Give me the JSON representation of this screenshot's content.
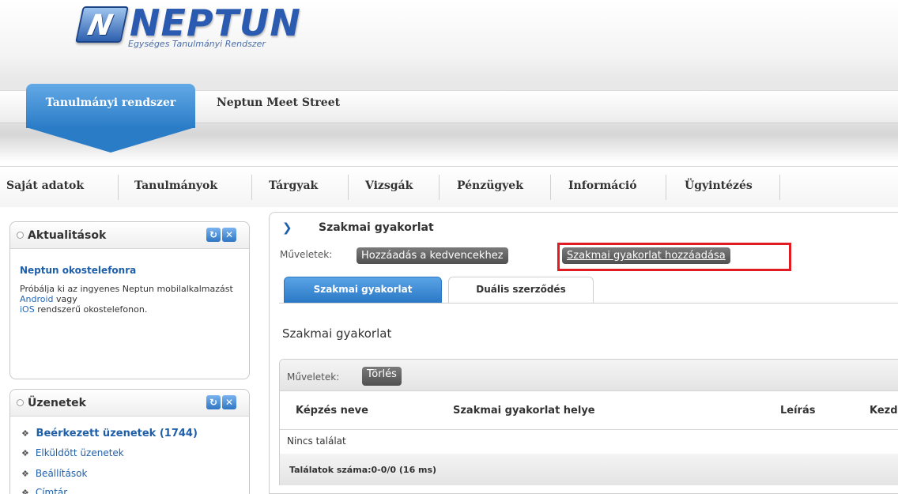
{
  "brand": {
    "badge_letter": "N",
    "name": "NEPTUN",
    "subtitle": "Egységes Tanulmányi Rendszer"
  },
  "top_tabs": [
    {
      "label": "Tanulmányi rendszer",
      "active": true
    },
    {
      "label": "Neptun Meet Street",
      "active": false
    }
  ],
  "main_menu": [
    {
      "label": "Saját adatok"
    },
    {
      "label": "Tanulmányok"
    },
    {
      "label": "Tárgyak"
    },
    {
      "label": "Vizsgák"
    },
    {
      "label": "Pénzügyek"
    },
    {
      "label": "Információ"
    },
    {
      "label": "Ügyintézés"
    }
  ],
  "news_box": {
    "title": "Aktualitások",
    "item_title": "Neptun okostelefonra",
    "text_part1": "Próbálja ki az ingyenes Neptun mobilalkalmazást ",
    "link_android": "Android",
    "text_part2": " vagy ",
    "link_ios": "iOS",
    "text_part3": " rendszerű okostelefonon."
  },
  "messages_box": {
    "title": "Üzenetek",
    "items": [
      {
        "label": "Beérkezett üzenetek (1744)"
      },
      {
        "label": "Elküldött üzenetek"
      },
      {
        "label": "Beállítások"
      },
      {
        "label": "Címtár"
      }
    ]
  },
  "box_buttons": {
    "refresh": "↻",
    "close": "✕"
  },
  "panel": {
    "title": "Szakmai gyakorlat",
    "operations_label": "Műveletek:",
    "add_favorite": "Hozzáadás a kedvencekhez",
    "add_internship": "Szakmai gyakorlat hozzáadása",
    "tabs": [
      {
        "label": "Szakmai gyakorlat",
        "active": true
      },
      {
        "label": "Duális szerződés",
        "active": false
      }
    ],
    "section_title": "Szakmai gyakorlat",
    "grid": {
      "operations_label": "Műveletek:",
      "delete_button": "Törlés",
      "columns": [
        "Képzés neve",
        "Szakmai gyakorlat helye",
        "Leírás",
        "Kezd"
      ],
      "empty_text": "Nincs találat",
      "footer": "Találatok száma:0-0/0 (16 ms)"
    }
  },
  "colors": {
    "accent_blue": "#2b7cc7",
    "link_blue": "#1f5fa9",
    "highlight_red": "#e11b22"
  },
  "icons": {
    "panel_title": "chevron-right-icon",
    "message_item": "diamond-bullet-icon",
    "box_header": "circle-bullet-icon"
  }
}
